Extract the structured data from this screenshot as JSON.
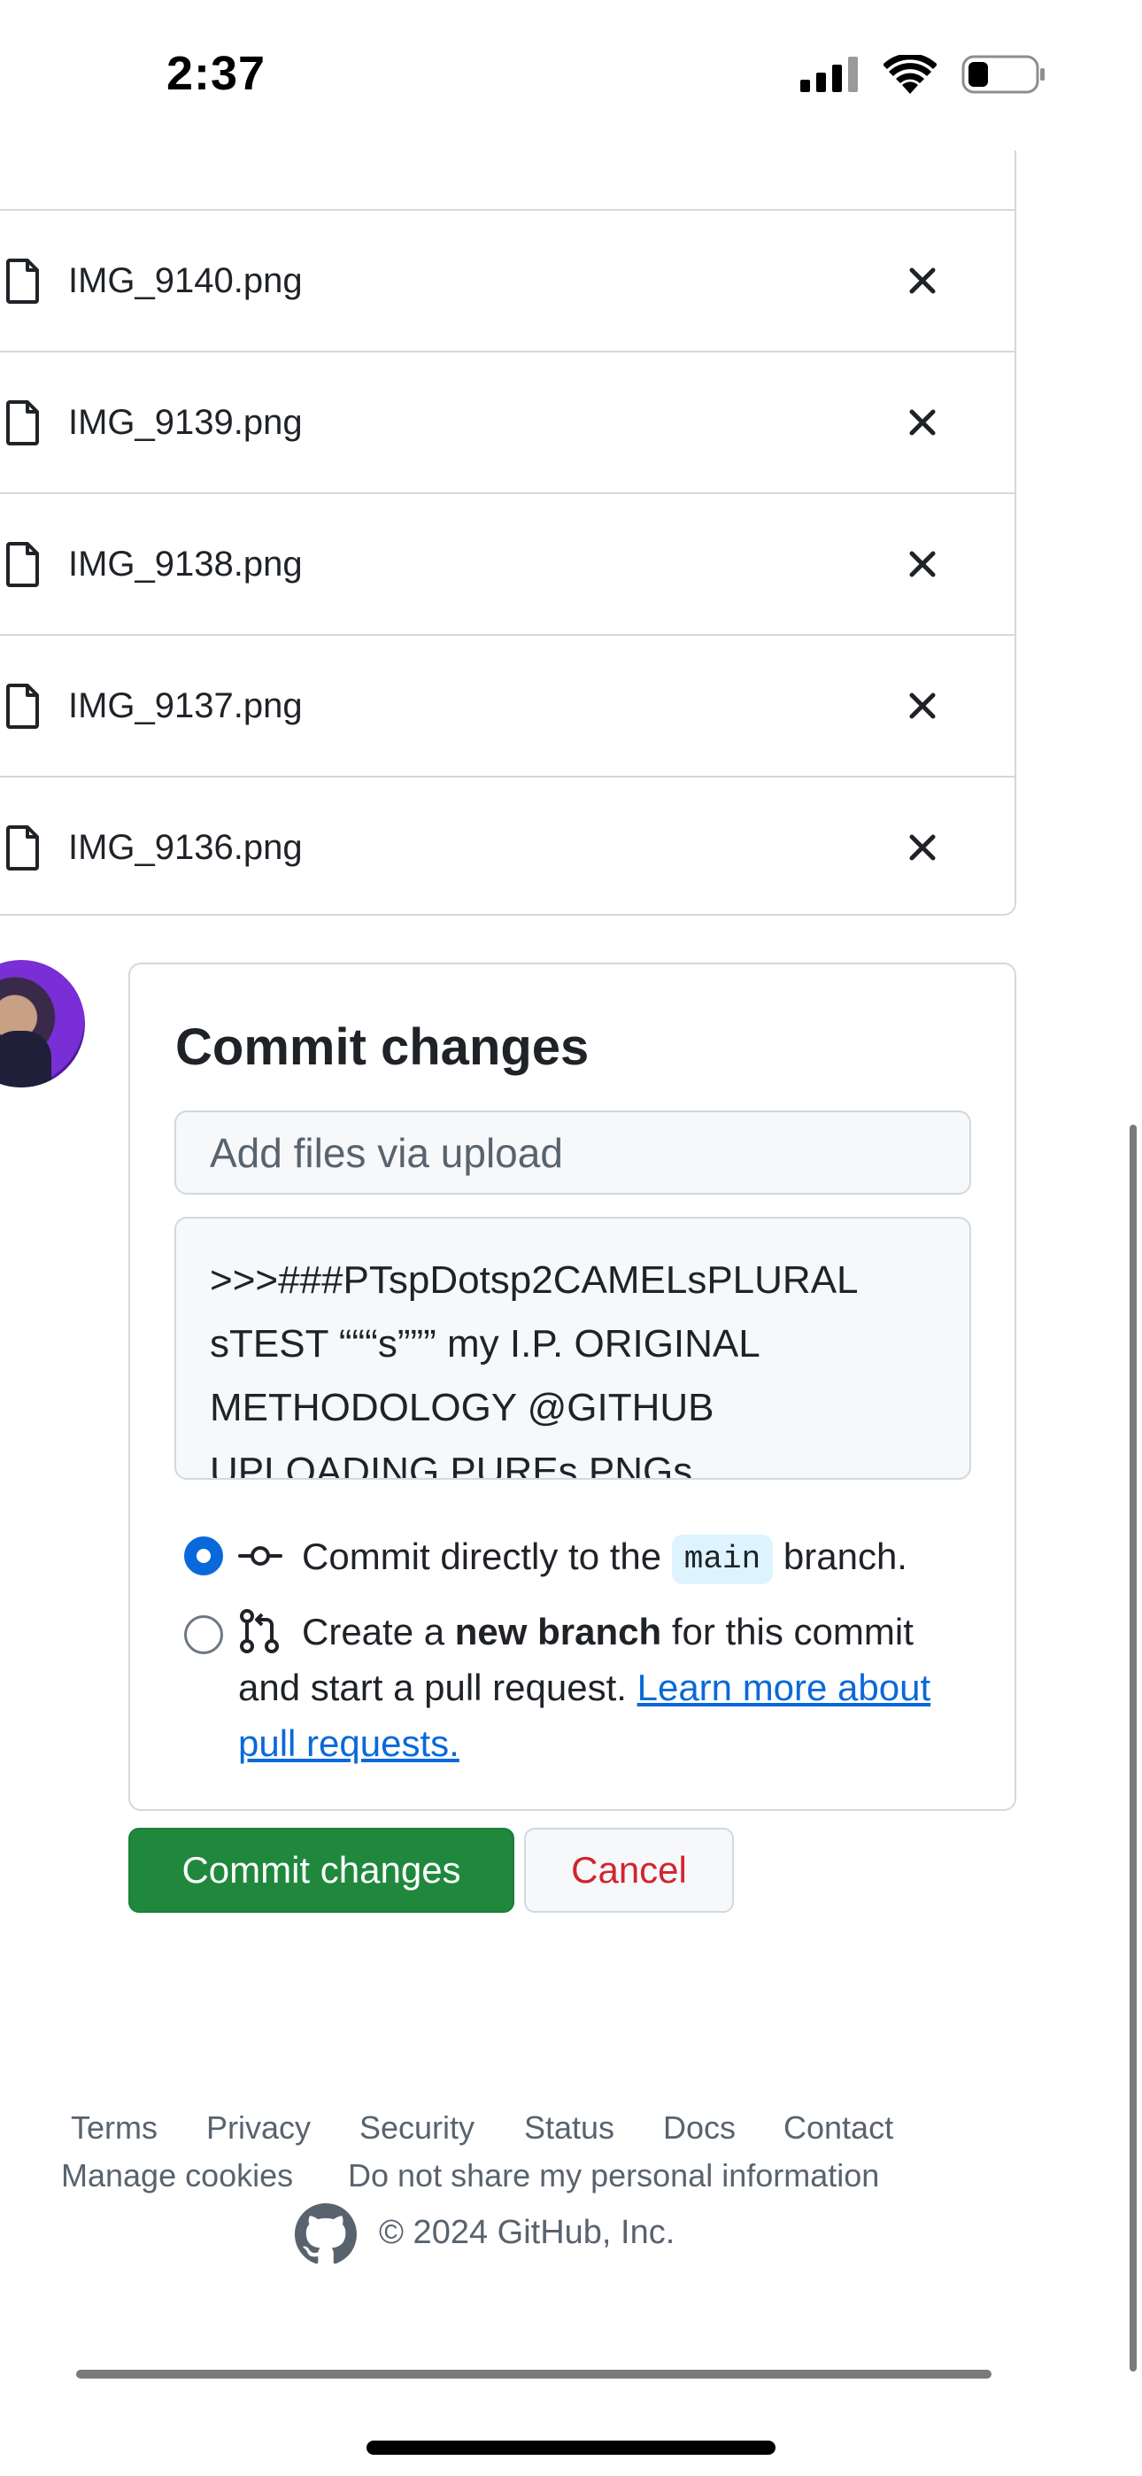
{
  "status_bar": {
    "time": "2:37"
  },
  "files": [
    {
      "name": "IMG_9140.png"
    },
    {
      "name": "IMG_9139.png"
    },
    {
      "name": "IMG_9138.png"
    },
    {
      "name": "IMG_9137.png"
    },
    {
      "name": "IMG_9136.png"
    }
  ],
  "commit": {
    "title": "Commit changes",
    "summary_placeholder": "Add files via upload",
    "description": ">>>###PTspDotsp2CAMELsPLURAL sTEST “““s””” my I.P. ORIGINAL METHODOLOGY @GITHUB UPLOADING PUREs PNGs",
    "option_direct_pre": "Commit directly to the",
    "option_direct_branch": "main",
    "option_direct_post": "branch.",
    "option_new_pre": "Create a",
    "option_new_bold": "new branch",
    "option_new_post": "for this commit and start a pull request.",
    "option_new_link": "Learn more about pull requests.",
    "selected_option": "direct"
  },
  "buttons": {
    "commit_label": "Commit changes",
    "cancel_label": "Cancel"
  },
  "footer": {
    "links": [
      "Terms",
      "Privacy",
      "Security",
      "Status",
      "Docs",
      "Contact"
    ],
    "manage_cookies": "Manage cookies",
    "do_not_share": "Do not share my personal information",
    "copyright": "© 2024 GitHub, Inc."
  },
  "colors": {
    "primary_green": "#1f883d",
    "cancel_red": "#d1242f",
    "link_blue": "#0969da",
    "border": "#d1d9e0"
  }
}
